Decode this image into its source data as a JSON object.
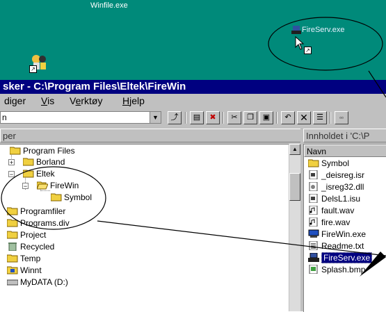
{
  "desktop": {
    "winfile_label": "Winfile.exe",
    "fireserv_label": "FireServ.exe"
  },
  "window": {
    "title": "sker - C:\\Program Files\\Eltek\\FireWin",
    "menu": [
      {
        "pre": "",
        "u": "",
        "post": "diger"
      },
      {
        "pre": "",
        "u": "V",
        "post": "is"
      },
      {
        "pre": "V",
        "u": "e",
        "post": "rktøy"
      },
      {
        "pre": "",
        "u": "H",
        "post": "jelp"
      }
    ],
    "address_value": "n",
    "left_pane_header": "per",
    "right_pane_header": "Innholdet i 'C:\\P",
    "name_column": "Navn"
  },
  "tree": [
    {
      "label": "Program Files",
      "expander": ""
    },
    {
      "label": "Borland",
      "expander": "+"
    },
    {
      "label": "Eltek",
      "expander": "−"
    },
    {
      "label": "FireWin",
      "expander": "−"
    },
    {
      "label": "Symbol",
      "expander": ""
    },
    {
      "label": "Programfiler",
      "expander": ""
    },
    {
      "label": "Programs.div",
      "expander": ""
    },
    {
      "label": "Project",
      "expander": ""
    },
    {
      "label": "Recycled",
      "expander": ""
    },
    {
      "label": "Temp",
      "expander": ""
    },
    {
      "label": "Winnt",
      "expander": ""
    },
    {
      "label": "MyDATA (D:)",
      "expander": ""
    }
  ],
  "files": [
    {
      "name": "Symbol",
      "icon": "folder-icon"
    },
    {
      "name": "_deisreg.isr",
      "icon": "file-icon"
    },
    {
      "name": "_isreg32.dll",
      "icon": "dll-icon"
    },
    {
      "name": "DelsL1.isu",
      "icon": "file-icon"
    },
    {
      "name": "fault.wav",
      "icon": "sound-icon"
    },
    {
      "name": "fire.wav",
      "icon": "sound-icon"
    },
    {
      "name": "FireWin.exe",
      "icon": "app-icon"
    },
    {
      "name": "Readme.txt",
      "icon": "text-icon"
    },
    {
      "name": "FireServ.exe",
      "icon": "server-app-icon",
      "selected": true
    },
    {
      "name": "Splash.bmp",
      "icon": "image-icon"
    }
  ],
  "colors": {
    "desktop": "#008a7a",
    "titlebar": "#000080",
    "selection": "#000080",
    "folder": "#f0d040"
  }
}
